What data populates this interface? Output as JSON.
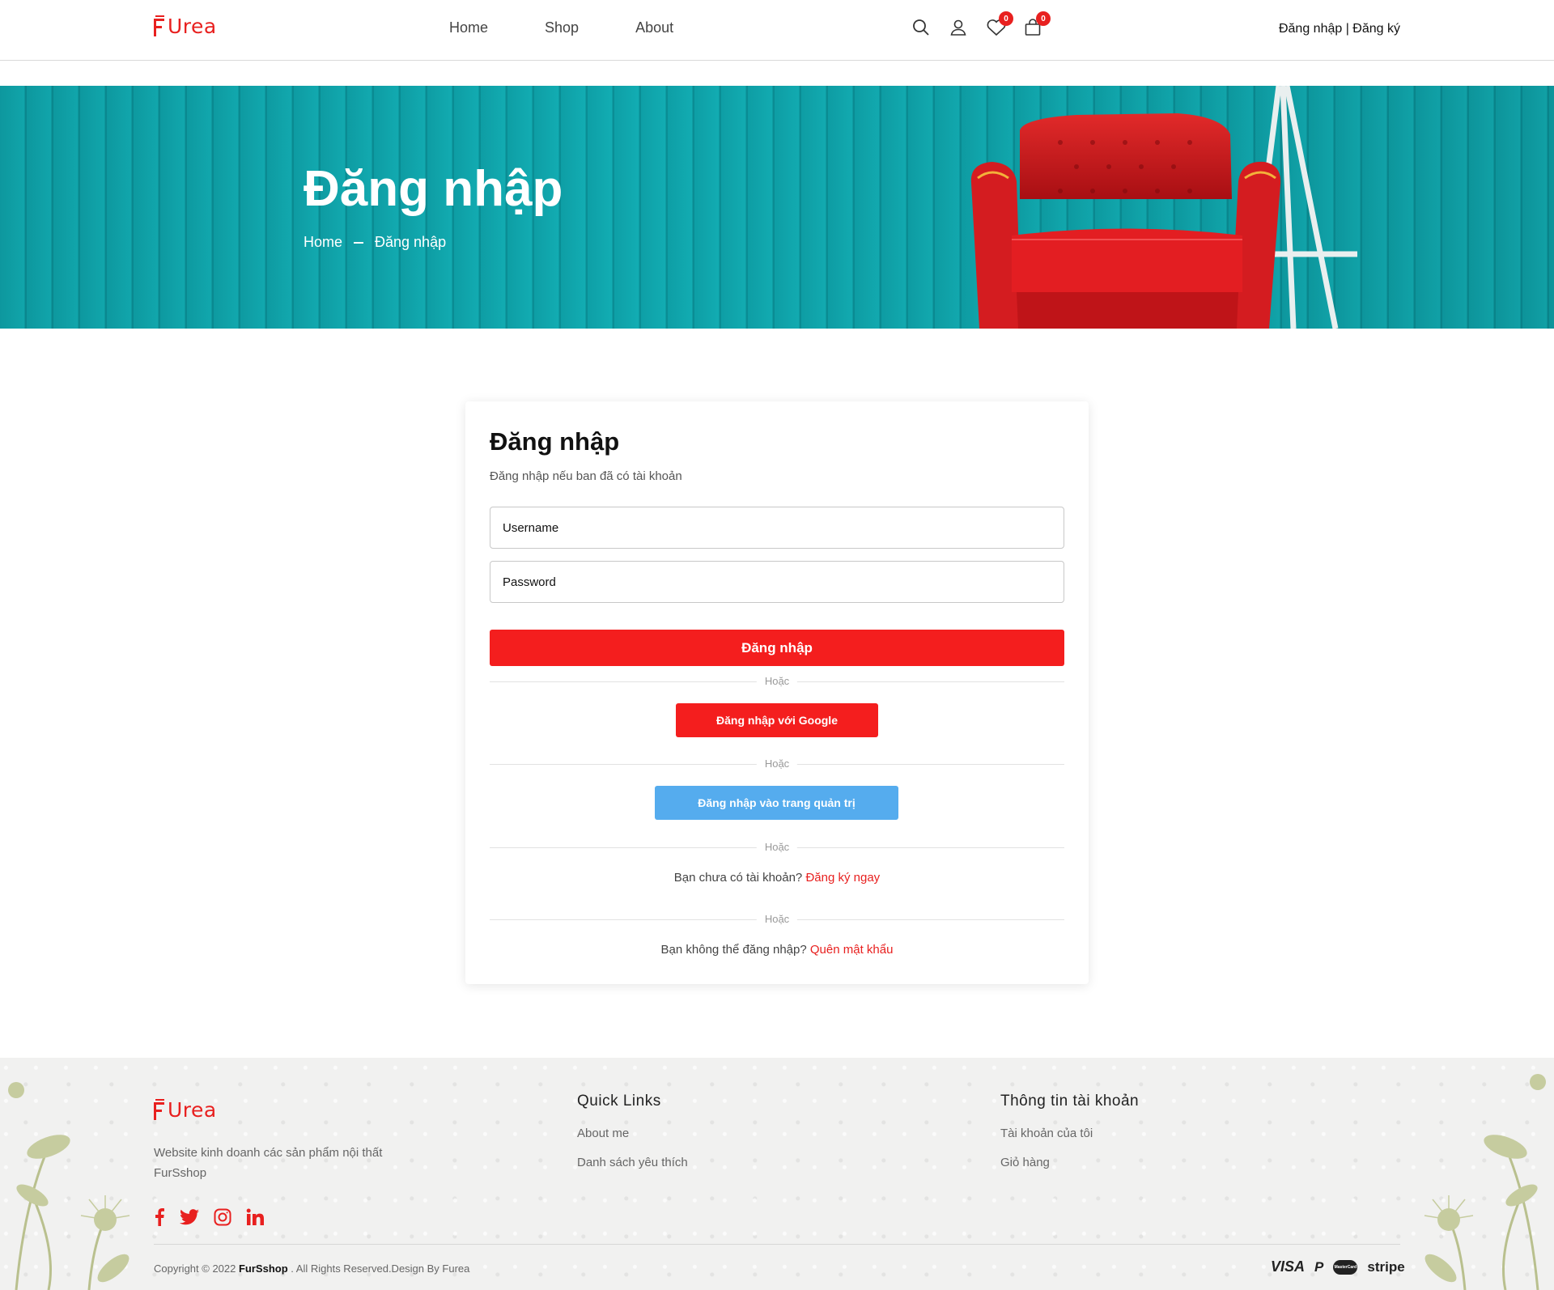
{
  "brand": {
    "logo_text": "Urea",
    "accent": "#e8201f"
  },
  "header": {
    "nav": [
      "Home",
      "Shop",
      "About"
    ],
    "wishlist_count": "0",
    "cart_count": "0",
    "auth_text": "Đăng nhập | Đăng ký",
    "icons": [
      "search-icon",
      "user-icon",
      "heart-icon",
      "bag-icon"
    ]
  },
  "hero": {
    "title": "Đăng nhập",
    "breadcrumb": [
      "Home",
      "Đăng nhập"
    ]
  },
  "login": {
    "title": "Đăng nhập",
    "subtitle": "Đăng nhập nếu ban đã có tài khoản",
    "username_placeholder": "Username",
    "password_placeholder": "Password",
    "submit_label": "Đăng nhập",
    "divider_text": "Hoặc",
    "google_label": "Đăng nhập với Google",
    "admin_label": "Đăng nhập vào trang quản trị",
    "register_prompt": "Bạn chưa có tài khoản?",
    "register_link": "Đăng ký ngay",
    "forgot_prompt": "Bạn không thể đăng nhập?",
    "forgot_link": "Quên mật khẩu",
    "colors": {
      "primary_button": "#f41e1e",
      "admin_button": "#55acee"
    }
  },
  "footer": {
    "about_text": "Website kinh doanh các sản phẩm nội thất FurSshop",
    "quick_links_title": "Quick Links",
    "quick_links": [
      "About me",
      "Danh sách yêu thích"
    ],
    "account_title": "Thông tin tài khoản",
    "account_links": [
      "Tài khoản của tôi",
      "Giỏ hàng"
    ],
    "social_icons": [
      "facebook-icon",
      "twitter-icon",
      "instagram-icon",
      "linkedin-icon"
    ],
    "copyright_pre": "Copyright © 2022",
    "copyright_brand": "FurSshop",
    "copyright_post": ". All Rights Reserved.Design By Furea",
    "payments": [
      "VISA",
      "P",
      "MasterCard",
      "stripe"
    ]
  }
}
